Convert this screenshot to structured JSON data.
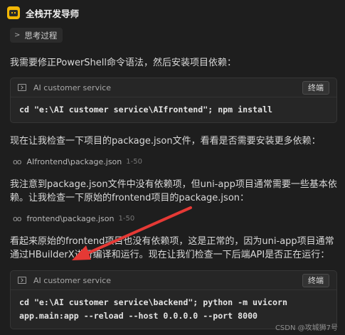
{
  "header": {
    "title": "全栈开发导师"
  },
  "thinking": {
    "label": "思考过程"
  },
  "para1": "我需要修正PowerShell命令语法，然后安装项目依赖：",
  "term1": {
    "label": "AI customer service",
    "button": "终端",
    "command": "cd \"e:\\AI customer service\\AIfrontend\"; npm install"
  },
  "para2": "现在让我检查一下项目的package.json文件，看看是否需要安装更多依赖：",
  "file1": {
    "path": "AIfrontend\\package.json",
    "range": "1-50"
  },
  "para3": "我注意到package.json文件中没有依赖项，但uni-app项目通常需要一些基本依赖。让我检查一下原始的frontend项目的package.json：",
  "file2": {
    "path": "frontend\\package.json",
    "range": "1-50"
  },
  "para4": "看起来原始的frontend项目也没有依赖项，这是正常的，因为uni-app项目通常通过HBuilderX进行编译和运行。现在让我们检查一下后端API是否正在运行：",
  "term2": {
    "label": "AI customer service",
    "button": "终端",
    "command": "cd \"e:\\AI customer service\\backend\"; python -m uvicorn\napp.main:app --reload --host 0.0.0.0 --port 8000"
  },
  "watermark": "CSDN @攻城狮7号",
  "colors": {
    "background": "#1e1e1e",
    "arrow": "#e53935",
    "avatar": "#f2b705"
  }
}
